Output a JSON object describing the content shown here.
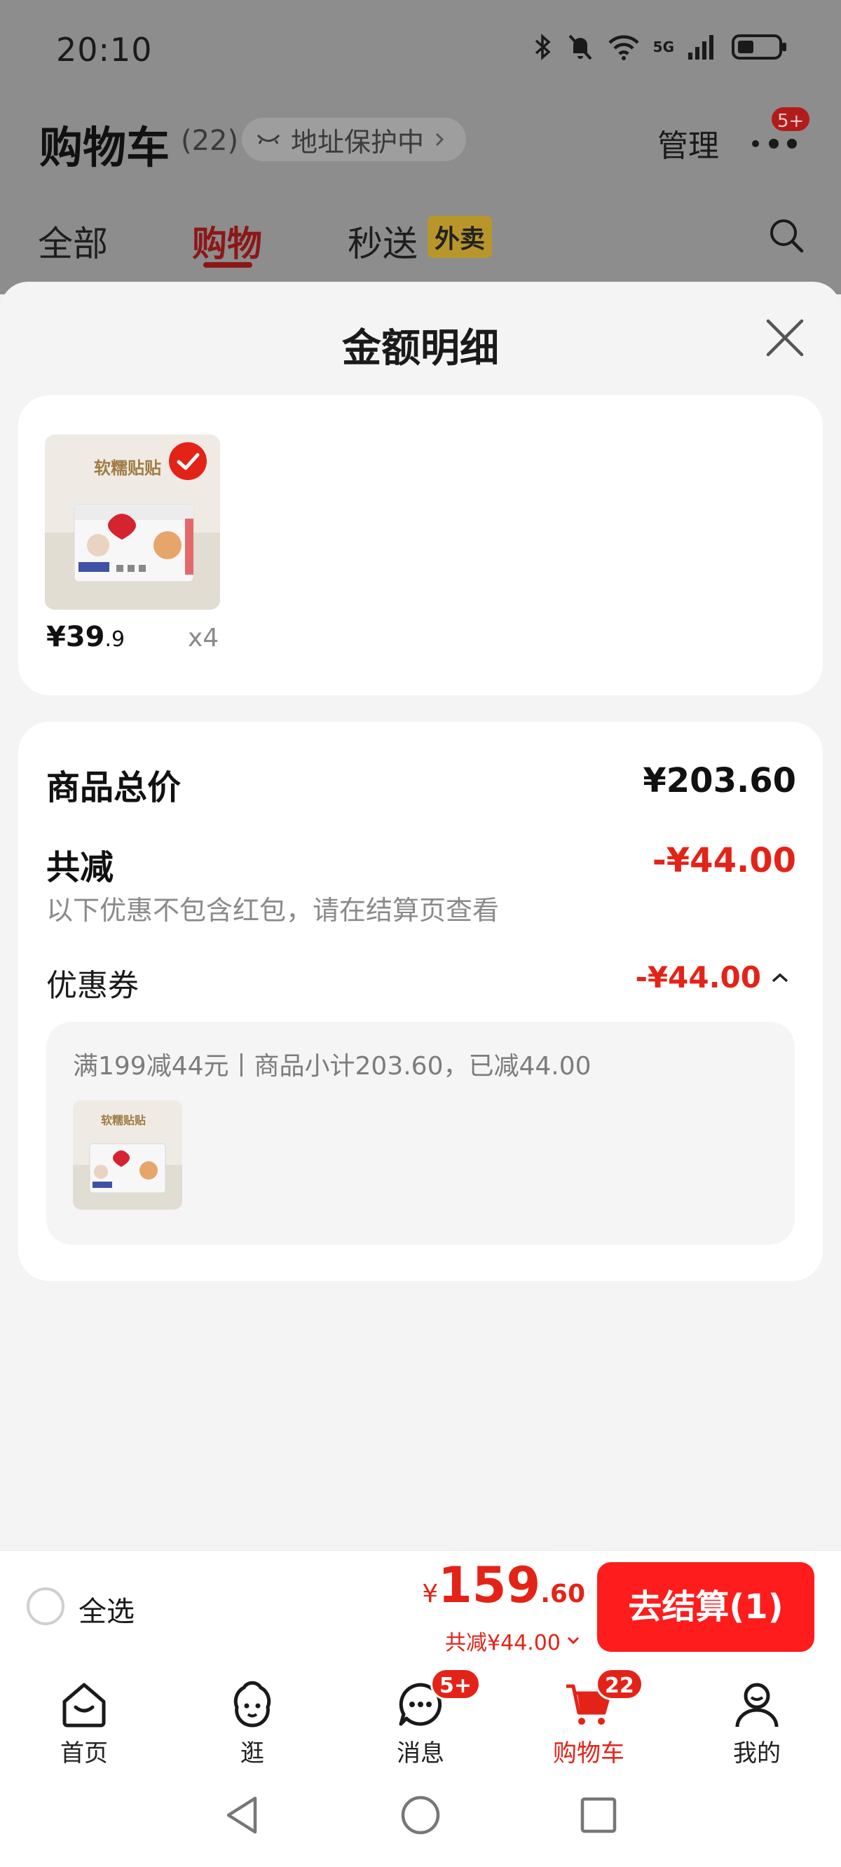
{
  "status_bar": {
    "time": "20:10",
    "network": "5G",
    "wifi_sub": "6"
  },
  "header": {
    "title": "购物车",
    "count": "(22)",
    "address_pill": "地址保护中",
    "manage": "管理",
    "more_badge": "5+"
  },
  "tabs": [
    {
      "label": "全部"
    },
    {
      "label": "购物"
    },
    {
      "label": "秒送"
    }
  ],
  "waimai_tag": "外卖",
  "sheet": {
    "title": "金额明细",
    "product": {
      "thumb_text": "软糯贴贴",
      "price_int": "¥39",
      "price_dec": ".9",
      "qty": "x4"
    },
    "summary": {
      "total_label": "商品总价",
      "total_value": "¥203.60",
      "discount_label": "共减",
      "discount_value": "-¥44.00",
      "discount_note": "以下优惠不包含红包，请在结算页查看",
      "coupon_label": "优惠券",
      "coupon_value": "-¥44.00",
      "coupon_desc": "满199减44元丨商品小计203.60，已减44.00",
      "coupon_thumb_text": "软糯贴贴"
    }
  },
  "checkout": {
    "select_all": "全选",
    "total_currency": "¥",
    "total_int": "159",
    "total_dec": ".60",
    "total_discount": "共减¥44.00",
    "button": "去结算(1)"
  },
  "tabbar": [
    {
      "label": "首页",
      "icon": "home-icon"
    },
    {
      "label": "逛",
      "icon": "browse-icon"
    },
    {
      "label": "消息",
      "icon": "message-icon",
      "badge": "5+"
    },
    {
      "label": "购物车",
      "icon": "cart-icon",
      "badge": "22"
    },
    {
      "label": "我的",
      "icon": "profile-icon"
    }
  ],
  "colors": {
    "accent": "#e42318",
    "checkout_button": "#ff1c1c"
  }
}
